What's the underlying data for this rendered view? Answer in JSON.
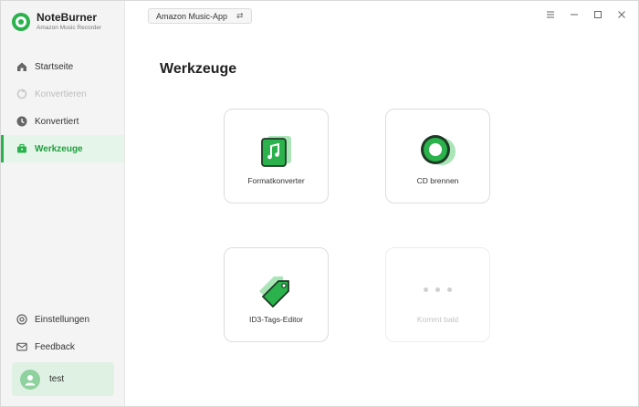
{
  "app": {
    "name": "NoteBurner",
    "subtitle": "Amazon Music Recorder"
  },
  "sidebar": {
    "items": [
      {
        "label": "Startseite",
        "icon": "home-icon",
        "state": "normal"
      },
      {
        "label": "Konvertieren",
        "icon": "convert-icon",
        "state": "disabled"
      },
      {
        "label": "Konvertiert",
        "icon": "clock-icon",
        "state": "normal"
      },
      {
        "label": "Werkzeuge",
        "icon": "toolbox-icon",
        "state": "active"
      }
    ],
    "bottom_items": [
      {
        "label": "Einstellungen",
        "icon": "gear-icon"
      },
      {
        "label": "Feedback",
        "icon": "mail-icon"
      }
    ],
    "user": {
      "name": "test"
    }
  },
  "header": {
    "source_label": "Amazon Music-App",
    "controls": [
      "menu-icon",
      "minimize-icon",
      "maximize-icon",
      "close-icon"
    ]
  },
  "main": {
    "title": "Werkzeuge",
    "tools": [
      {
        "label": "Formatkonverter",
        "icon": "format-converter-icon"
      },
      {
        "label": "CD brennen",
        "icon": "cd-burn-icon"
      },
      {
        "label": "ID3-Tags-Editor",
        "icon": "tag-editor-icon"
      },
      {
        "label": "Kommt bald",
        "icon": "more-dots-icon"
      }
    ]
  },
  "colors": {
    "accent": "#2bb24c",
    "active_bg": "#e6f5e9",
    "sidebar_bg": "#f4f4f4"
  }
}
